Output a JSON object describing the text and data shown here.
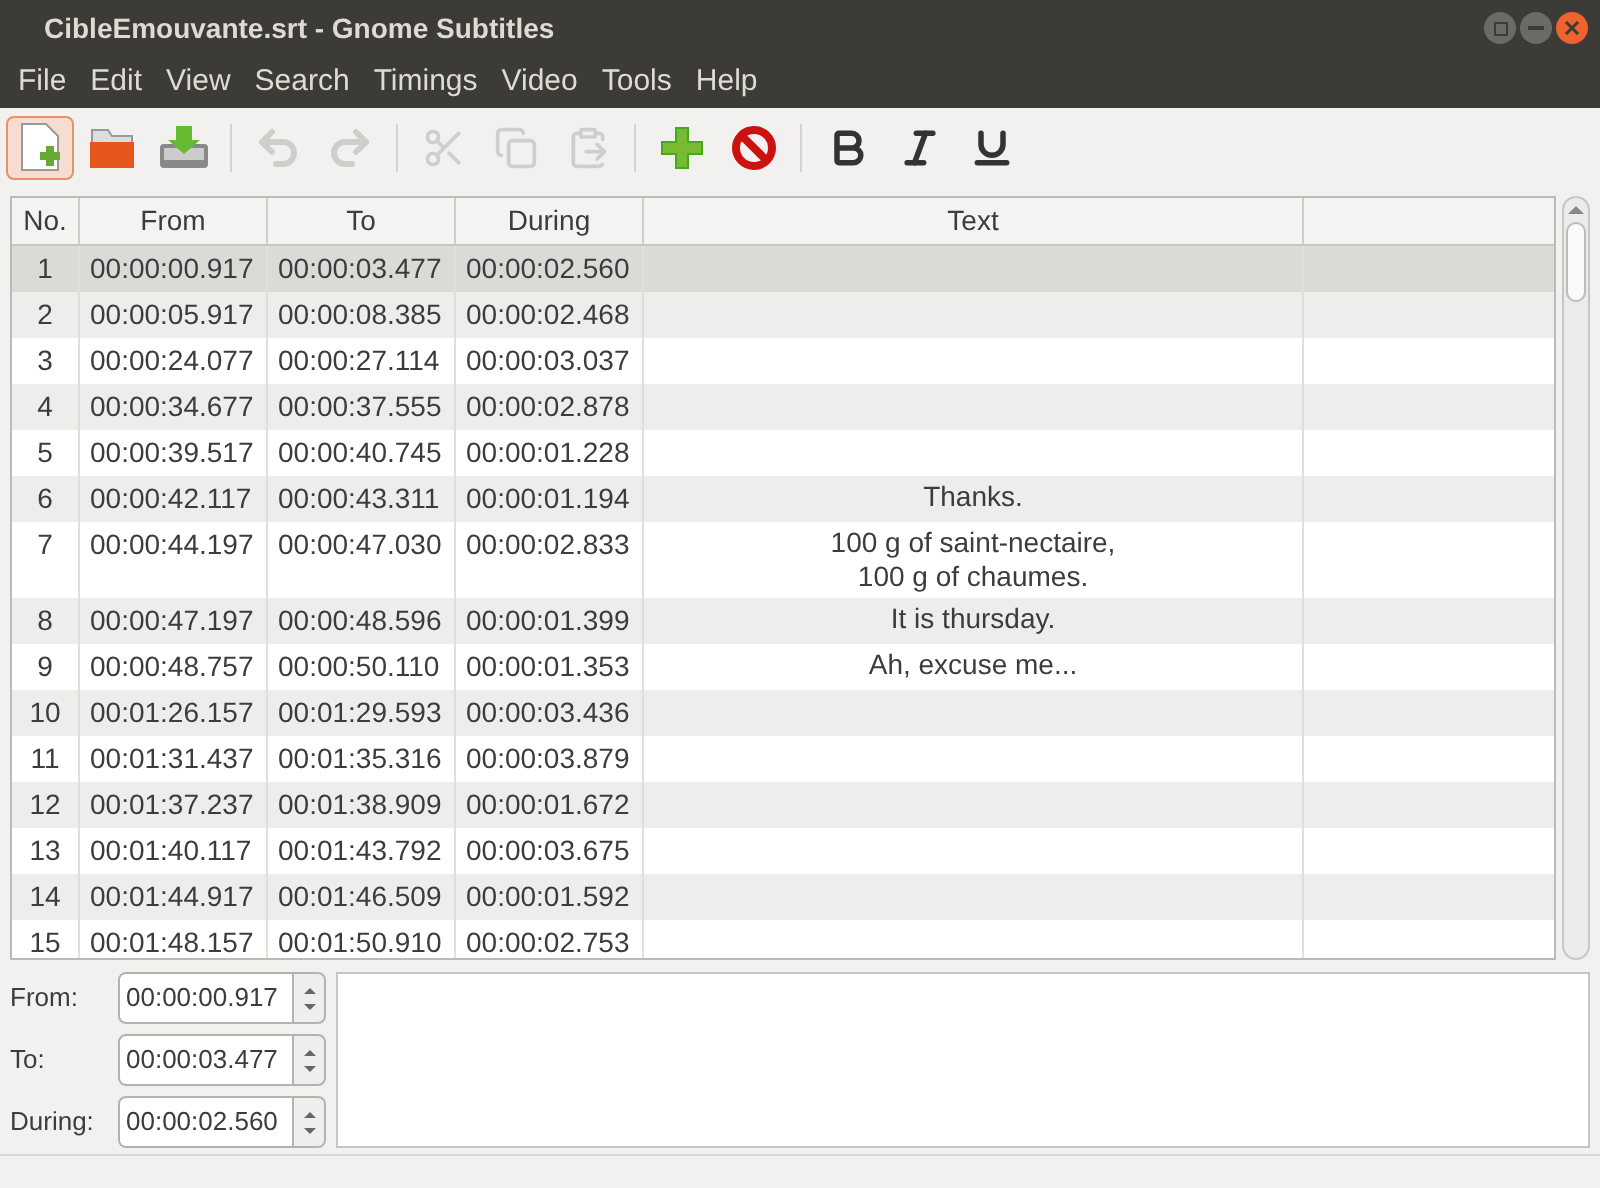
{
  "window": {
    "title": "CibleEmouvante.srt - Gnome Subtitles"
  },
  "menu": [
    "File",
    "Edit",
    "View",
    "Search",
    "Timings",
    "Video",
    "Tools",
    "Help"
  ],
  "toolbar": [
    {
      "kind": "new",
      "disabled": false,
      "selected": true
    },
    {
      "kind": "open",
      "disabled": false,
      "selected": false
    },
    {
      "kind": "save",
      "disabled": false,
      "selected": false
    },
    {
      "kind": "separator"
    },
    {
      "kind": "undo",
      "disabled": true,
      "selected": false
    },
    {
      "kind": "redo",
      "disabled": true,
      "selected": false
    },
    {
      "kind": "separator"
    },
    {
      "kind": "cut",
      "disabled": true,
      "selected": false
    },
    {
      "kind": "copy",
      "disabled": true,
      "selected": false
    },
    {
      "kind": "paste",
      "disabled": true,
      "selected": false
    },
    {
      "kind": "separator"
    },
    {
      "kind": "add",
      "disabled": false,
      "selected": false
    },
    {
      "kind": "remove",
      "disabled": false,
      "selected": false
    },
    {
      "kind": "separator"
    },
    {
      "kind": "bold",
      "disabled": false,
      "selected": false
    },
    {
      "kind": "italic",
      "disabled": false,
      "selected": false
    },
    {
      "kind": "underline",
      "disabled": false,
      "selected": false
    }
  ],
  "table": {
    "columns": [
      "No.",
      "From",
      "To",
      "During",
      "Text"
    ],
    "rows": [
      {
        "no": "1",
        "from": "00:00:00.917",
        "to": "00:00:03.477",
        "during": "00:00:02.560",
        "text": [],
        "selected": true
      },
      {
        "no": "2",
        "from": "00:00:05.917",
        "to": "00:00:08.385",
        "during": "00:00:02.468",
        "text": [],
        "selected": false
      },
      {
        "no": "3",
        "from": "00:00:24.077",
        "to": "00:00:27.114",
        "during": "00:00:03.037",
        "text": [],
        "selected": false
      },
      {
        "no": "4",
        "from": "00:00:34.677",
        "to": "00:00:37.555",
        "during": "00:00:02.878",
        "text": [],
        "selected": false
      },
      {
        "no": "5",
        "from": "00:00:39.517",
        "to": "00:00:40.745",
        "during": "00:00:01.228",
        "text": [],
        "selected": false
      },
      {
        "no": "6",
        "from": "00:00:42.117",
        "to": "00:00:43.311",
        "during": "00:00:01.194",
        "text": [
          "Thanks."
        ],
        "selected": false
      },
      {
        "no": "7",
        "from": "00:00:44.197",
        "to": "00:00:47.030",
        "during": "00:00:02.833",
        "text": [
          "100 g of saint-nectaire,",
          "100 g of chaumes."
        ],
        "selected": false
      },
      {
        "no": "8",
        "from": "00:00:47.197",
        "to": "00:00:48.596",
        "during": "00:00:01.399",
        "text": [
          "It is thursday."
        ],
        "selected": false
      },
      {
        "no": "9",
        "from": "00:00:48.757",
        "to": "00:00:50.110",
        "during": "00:00:01.353",
        "text": [
          "Ah, excuse me..."
        ],
        "selected": false
      },
      {
        "no": "10",
        "from": "00:01:26.157",
        "to": "00:01:29.593",
        "during": "00:00:03.436",
        "text": [],
        "selected": false
      },
      {
        "no": "11",
        "from": "00:01:31.437",
        "to": "00:01:35.316",
        "during": "00:00:03.879",
        "text": [],
        "selected": false
      },
      {
        "no": "12",
        "from": "00:01:37.237",
        "to": "00:01:38.909",
        "during": "00:00:01.672",
        "text": [],
        "selected": false
      },
      {
        "no": "13",
        "from": "00:01:40.117",
        "to": "00:01:43.792",
        "during": "00:00:03.675",
        "text": [],
        "selected": false
      },
      {
        "no": "14",
        "from": "00:01:44.917",
        "to": "00:01:46.509",
        "during": "00:00:01.592",
        "text": [],
        "selected": false
      },
      {
        "no": "15",
        "from": "00:01:48.157",
        "to": "00:01:50.910",
        "during": "00:00:02.753",
        "text": [],
        "selected": false
      }
    ]
  },
  "editor": {
    "fields": [
      {
        "label": "From:",
        "value": "00:00:00.917"
      },
      {
        "label": "To:",
        "value": "00:00:03.477"
      },
      {
        "label": "During:",
        "value": "00:00:02.560"
      }
    ]
  }
}
